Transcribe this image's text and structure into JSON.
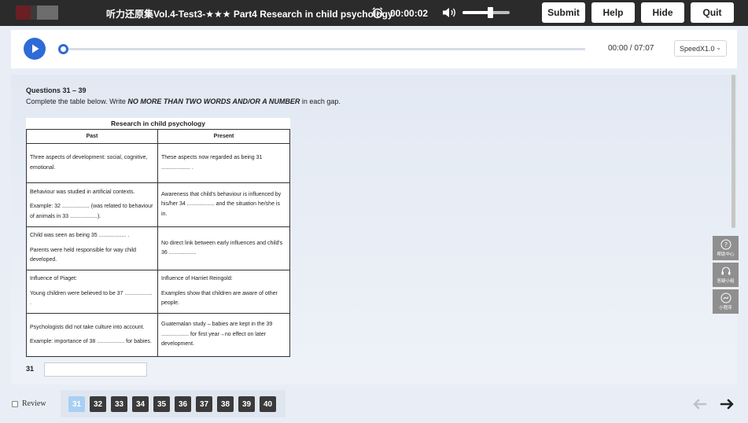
{
  "header": {
    "title": "听力还原集Vol.4-Test3-★★★ Part4 Research in child psychology",
    "timer": "00:00:02",
    "volume_level": 0.55,
    "buttons": {
      "submit": "Submit",
      "help": "Help",
      "hide": "Hide",
      "quit": "Quit"
    }
  },
  "audio": {
    "time": "00:00 / 07:07",
    "progress": 0,
    "speed": "SpeedX1.0"
  },
  "question": {
    "heading": "Questions 31 – 39",
    "instruction_pre": "Complete the table below. Write ",
    "instruction_em": "NO MORE THAN TWO WORDS AND/OR A NUMBER",
    "instruction_post": " in each gap.",
    "table": {
      "title": "Research in child psychology",
      "headers": [
        "Past",
        "Present"
      ],
      "rows": [
        {
          "past": [
            "Three aspects of development: social, cognitive, emotional."
          ],
          "present": [
            "These aspects now regarded as being 31 ................... ."
          ]
        },
        {
          "past": [
            "Behaviour was studied in artificial contexts.",
            "Example: 32 .................. (was related to behaviour of animals in 33 ..................)."
          ],
          "present": [
            "Awareness that child's behaviour is influenced by his/her 34 .................. and the situation he/she is in."
          ]
        },
        {
          "past": [
            "Child was seen as being 35 .................. .",
            "Parents were held responsible for way child developed."
          ],
          "present": [
            "No direct link between early influences and child's 36 .................."
          ]
        },
        {
          "past": [
            "Influence of Piaget:",
            "Young children were believed to be 37 .................. ."
          ],
          "present": [
            "Influence of Harriet Reingold:",
            "Examples show that children are aware of other people."
          ]
        },
        {
          "past": [
            "Psychologists did not take culture into account.",
            "Example: importance of 38 .................. for babies."
          ],
          "present": [
            "Guatemalan study – babies are kept in the 39 .................. for first year→no effect on later development."
          ]
        }
      ]
    },
    "answer_label": "31",
    "answer_value": ""
  },
  "side_tools": [
    {
      "label": "帮助中心",
      "icon": "question-icon"
    },
    {
      "label": "答疑小组",
      "icon": "headset-icon"
    },
    {
      "label": "小程序",
      "icon": "mini-program-icon"
    }
  ],
  "footer": {
    "review_label": "Review",
    "question_numbers": [
      "31",
      "32",
      "33",
      "34",
      "35",
      "36",
      "37",
      "38",
      "39",
      "40"
    ],
    "active_question": "31"
  },
  "colors": {
    "accent": "#2e6bd6",
    "topbar": "#2b2b2b",
    "nav_button": "#3a3a3a",
    "nav_active": "#a9cff3"
  }
}
